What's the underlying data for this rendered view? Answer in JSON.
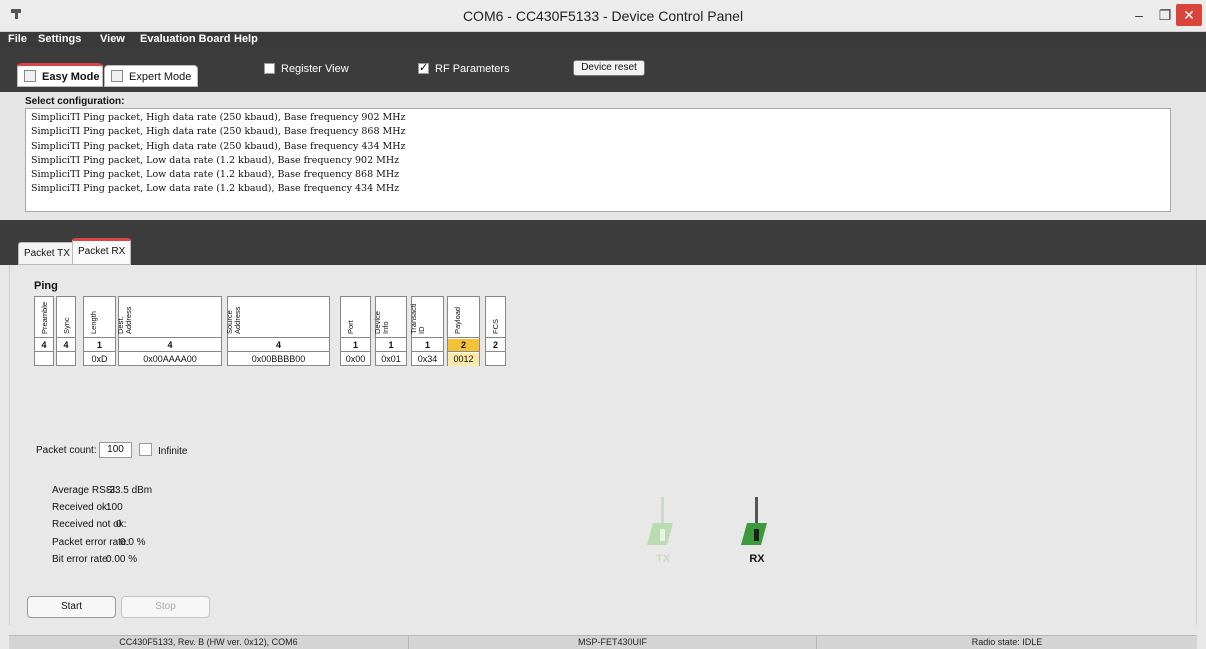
{
  "window": {
    "title": "COM6 - CC430F5133 - Device Control Panel",
    "minimize": "–",
    "maximize": "❐",
    "close": "✕"
  },
  "menu": [
    "File",
    "Settings",
    "View",
    "Evaluation Board",
    "Help"
  ],
  "modes": {
    "easy": "Easy Mode",
    "expert": "Expert Mode",
    "register_view": "Register View",
    "register_view_checked": false,
    "rf_parameters": "RF Parameters",
    "rf_parameters_checked": true,
    "device_reset": "Device reset"
  },
  "config": {
    "heading": "Select configuration:",
    "items": [
      "SimpliciTI Ping packet, High data rate (250 kbaud), Base frequency 902 MHz",
      "SimpliciTI Ping packet, High data rate (250 kbaud), Base frequency 868 MHz",
      "SimpliciTI Ping packet, High data rate (250 kbaud), Base frequency 434 MHz",
      "SimpliciTI Ping packet, Low data rate (1.2 kbaud), Base frequency 902 MHz",
      "SimpliciTI Ping packet, Low data rate (1.2 kbaud), Base frequency 868 MHz",
      "SimpliciTI Ping packet, Low data rate (1.2 kbaud), Base frequency 434 MHz"
    ]
  },
  "packet_tabs": {
    "tx": "Packet TX",
    "rx": "Packet RX"
  },
  "packet": {
    "title": "Ping",
    "fields": [
      {
        "header": "Preamble",
        "length": "4",
        "value": ""
      },
      {
        "header": "Sync",
        "length": "4",
        "value": ""
      },
      {
        "header": "Length",
        "length": "1",
        "value": "0xD"
      },
      {
        "header": "Dest.\nAddress",
        "length": "4",
        "value": "0x00AAAA00"
      },
      {
        "header": "Source\nAddress",
        "length": "4",
        "value": "0x00BBBB00"
      },
      {
        "header": "Port",
        "length": "1",
        "value": "0x00"
      },
      {
        "header": "Device\nInfo",
        "length": "1",
        "value": "0x01"
      },
      {
        "header": "Transacti\nID",
        "length": "1",
        "value": "0x34"
      },
      {
        "header": "Payload",
        "length": "2",
        "value": "0012"
      },
      {
        "header": "FCS",
        "length": "2",
        "value": ""
      }
    ]
  },
  "count": {
    "label": "Packet count:",
    "value": "100",
    "infinite_label": "Infinite"
  },
  "stats": {
    "avg_rssi_label": "Average RSSI:",
    "avg_rssi": "-33.5 dBm",
    "recv_ok_label": "Received ok:",
    "recv_ok": "100",
    "recv_not_ok_label": "Received not ok:",
    "recv_not_ok": "0",
    "per_label": "Packet error rate:",
    "per": "0.0 %",
    "ber_label": "Bit error rate:",
    "ber": "0.00 %"
  },
  "buttons": {
    "start": "Start",
    "stop": "Stop"
  },
  "indicators": {
    "tx": "TX",
    "rx": "RX",
    "tx_color": "#b9dcb0",
    "rx_color": "#3c9a3c"
  },
  "status": {
    "device": "CC430F5133, Rev. B (HW ver. 0x12), COM6",
    "programmer": "MSP-FET430UIF",
    "radio_state": "Radio state: IDLE"
  }
}
